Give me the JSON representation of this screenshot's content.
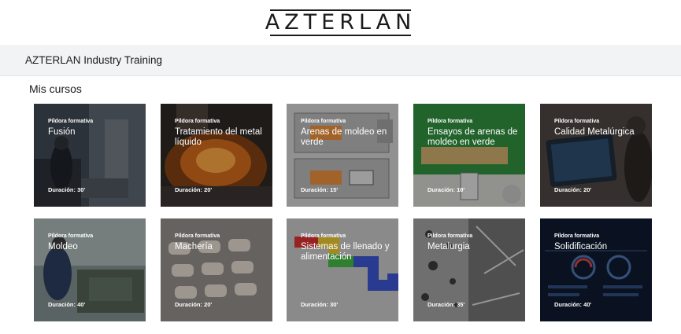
{
  "logo": "AZTERLAN",
  "header": {
    "title": "AZTERLAN Industry Training"
  },
  "section": {
    "title": "Mis cursos"
  },
  "courses": [
    {
      "kicker": "Píldora formativa",
      "title": "Fusión",
      "duration": "Duración: 30'"
    },
    {
      "kicker": "Píldora formativa",
      "title": "Tratamiento del metal líquido",
      "duration": "Duración: 20'"
    },
    {
      "kicker": "Píldora formativa",
      "title": "Arenas de moldeo en verde",
      "duration": "Duración: 15'"
    },
    {
      "kicker": "Píldora formativa",
      "title": "Ensayos de arenas de moldeo en verde",
      "duration": "Duración: 10'"
    },
    {
      "kicker": "Píldora formativa",
      "title": "Calidad Metalúrgica",
      "duration": "Duración: 20'"
    },
    {
      "kicker": "Píldora formativa",
      "title": "Moldeo",
      "duration": "Duración: 40'"
    },
    {
      "kicker": "Píldora formativa",
      "title": "Machería",
      "duration": "Duración: 20'"
    },
    {
      "kicker": "Píldora formativa",
      "title": "Sistemas de llenado y alimentación",
      "duration": "Duración: 30'"
    },
    {
      "kicker": "Píldora formativa",
      "title": "Metalurgia",
      "duration": "Duración: 35'"
    },
    {
      "kicker": "Píldora formativa",
      "title": "Solidificación",
      "duration": "Duración: 40'"
    }
  ]
}
